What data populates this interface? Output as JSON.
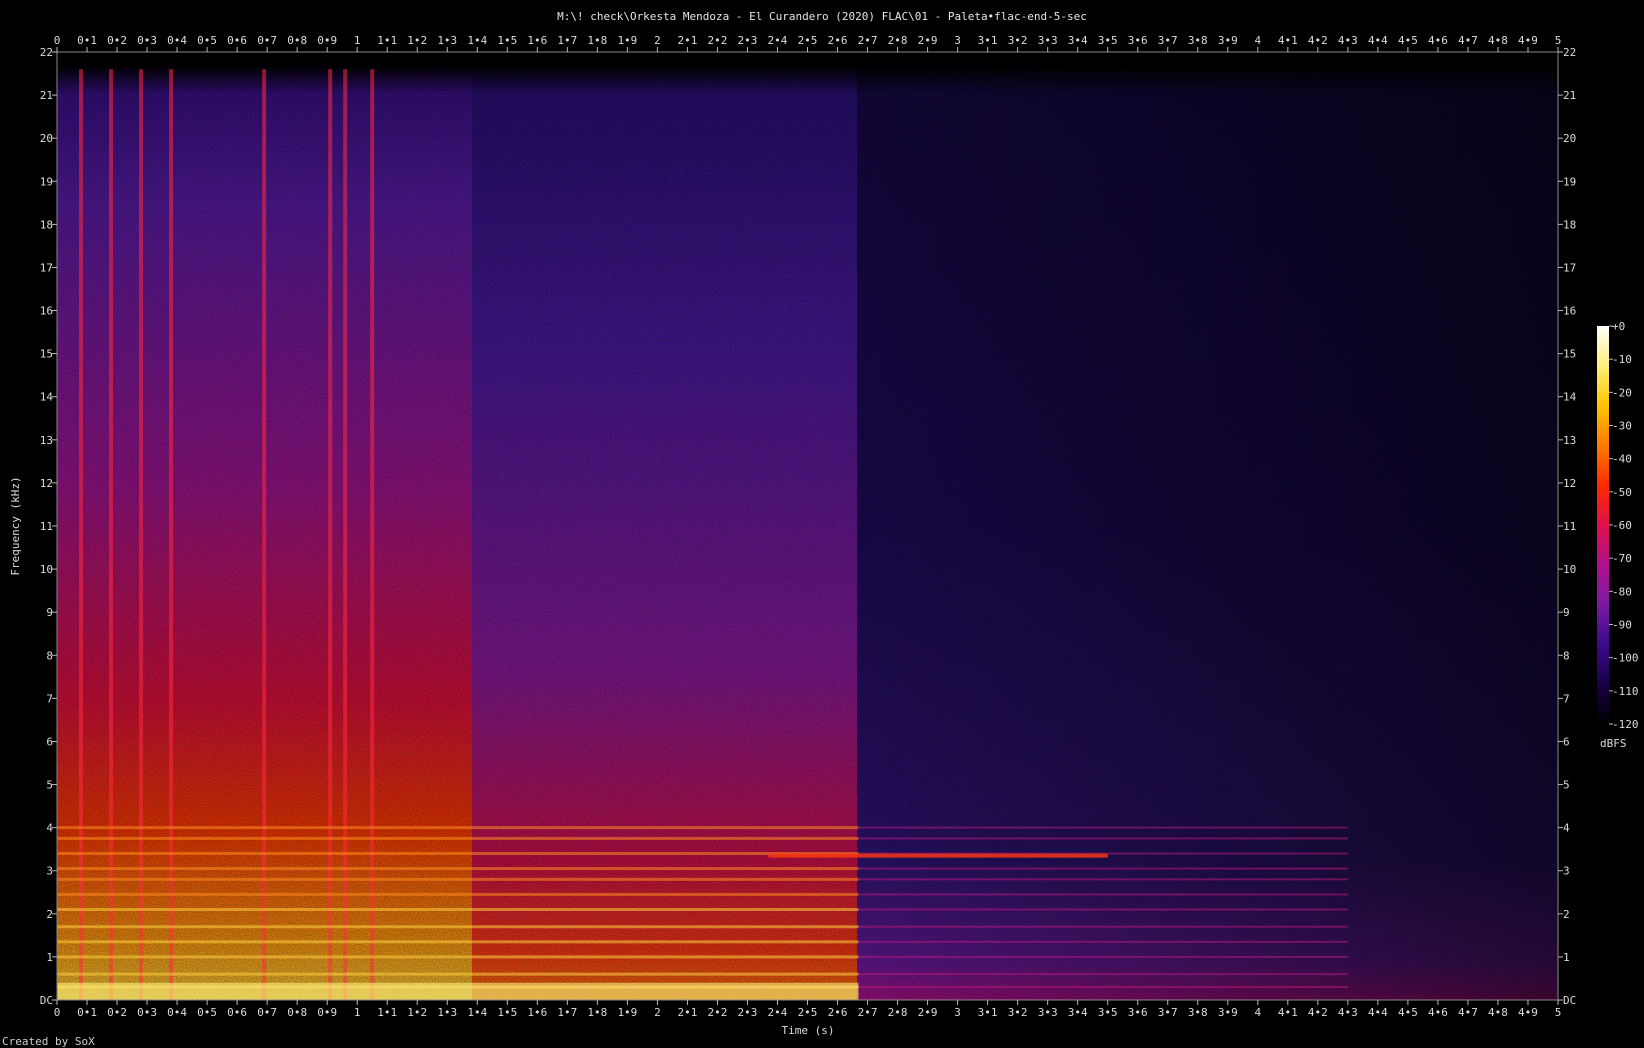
{
  "chart_data": {
    "type": "heatmap",
    "title": "M:\\! check\\Orkesta Mendoza - El Curandero (2020) FLAC\\01 - Paleta•flac-end-5-sec",
    "xlabel": "Time (s)",
    "ylabel": "Frequency (kHz)",
    "xlim": [
      0,
      5
    ],
    "ylim": [
      0,
      22
    ],
    "x_ticks": [
      "0",
      "0•1",
      "0•2",
      "0•3",
      "0•4",
      "0•5",
      "0•6",
      "0•7",
      "0•8",
      "0•9",
      "1",
      "1•1",
      "1•2",
      "1•3",
      "1•4",
      "1•5",
      "1•6",
      "1•7",
      "1•8",
      "1•9",
      "2",
      "2•1",
      "2•2",
      "2•3",
      "2•4",
      "2•5",
      "2•6",
      "2•7",
      "2•8",
      "2•9",
      "3",
      "3•1",
      "3•2",
      "3•3",
      "3•4",
      "3•5",
      "3•6",
      "3•7",
      "3•8",
      "3•9",
      "4",
      "4•1",
      "4•2",
      "4•3",
      "4•4",
      "4•5",
      "4•6",
      "4•7",
      "4•8",
      "4•9",
      "5"
    ],
    "y_ticks": [
      "DC",
      "1",
      "2",
      "3",
      "4",
      "5",
      "6",
      "7",
      "8",
      "9",
      "10",
      "11",
      "12",
      "13",
      "14",
      "15",
      "16",
      "17",
      "18",
      "19",
      "20",
      "21",
      "22"
    ],
    "colorbar": {
      "label": "dBFS",
      "range": [
        -120,
        0
      ],
      "ticks": [
        "+0",
        "-10",
        "-20",
        "-30",
        "-40",
        "-50",
        "-60",
        "-70",
        "-80",
        "-90",
        "-100",
        "-110",
        "-120"
      ],
      "colors": [
        "#000000",
        "#1a0046",
        "#3c0a8c",
        "#7a1aa0",
        "#b0108c",
        "#e0104a",
        "#ff2a00",
        "#ff7a00",
        "#ffc400",
        "#fff07a",
        "#ffffff"
      ]
    },
    "grid": false,
    "legend": "colorbar right",
    "footer": "Created by SoX"
  }
}
